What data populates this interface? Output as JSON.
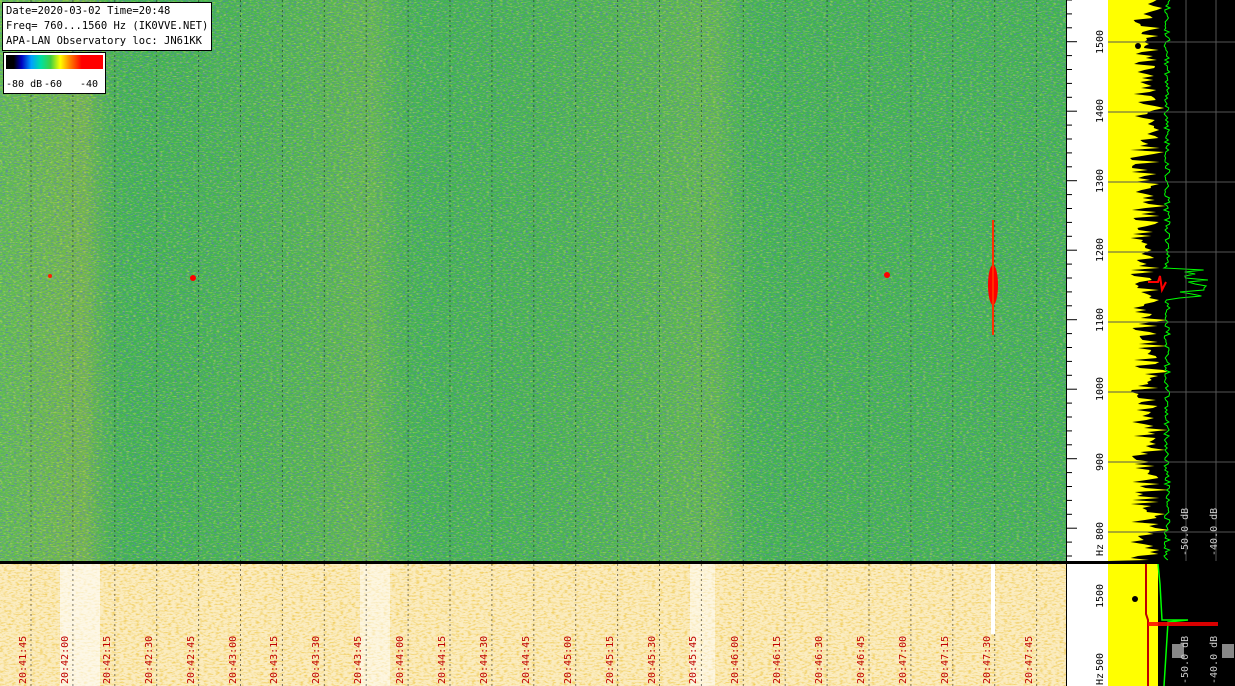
{
  "info": {
    "line1": "Date=2020-03-02 Time=20:48",
    "line2": "Freq= 760...1560 Hz (IK0VVE.NET)",
    "line3": "APA-LAN Observatory loc: JN61KK"
  },
  "colorbar": {
    "label_low": "-80 dB",
    "label_mid": "-60",
    "label_high": "-40"
  },
  "freq_axis": {
    "ticks": [
      "800",
      "900",
      "1000",
      "1100",
      "1200",
      "1300",
      "1400",
      "1500"
    ],
    "unit": "Hz"
  },
  "freq_axis_lower": {
    "ticks": [
      "500",
      "1500"
    ],
    "unit": "Hz"
  },
  "time_axis": {
    "ticks": [
      "20:41:45",
      "20:42:00",
      "20:42:15",
      "20:42:30",
      "20:42:45",
      "20:43:00",
      "20:43:15",
      "20:43:30",
      "20:43:45",
      "20:44:00",
      "20:44:15",
      "20:44:30",
      "20:44:45",
      "20:45:00",
      "20:45:15",
      "20:45:30",
      "20:45:45",
      "20:46:00",
      "20:46:15",
      "20:46:30",
      "20:46:45",
      "20:47:00",
      "20:47:15",
      "20:47:30",
      "20:47:45"
    ]
  },
  "spectrum": {
    "label_a": "-50.0 dB",
    "label_b": "-40.0 dB"
  },
  "colors": {
    "waterfall_base": "#3fb84a",
    "lower_base": "#f6d98a",
    "spectrum_fill": "#ffff00",
    "spectrum_line": "#00ff00",
    "marker_red": "#ff0000"
  }
}
